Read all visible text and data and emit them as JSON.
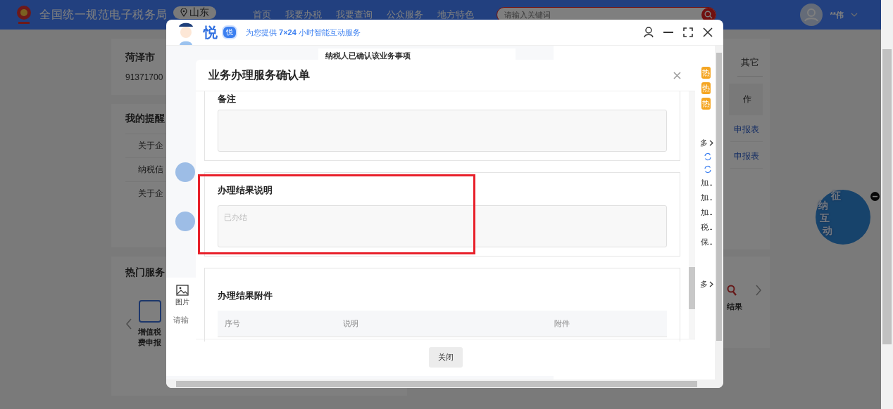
{
  "header": {
    "site_title": "全国统一规范电子税务局",
    "region": "山东",
    "nav": [
      "首页",
      "我要办税",
      "我要查询",
      "公众服务",
      "地方特色"
    ],
    "search": {
      "placeholder": "请输入关键词"
    },
    "user": "**伟"
  },
  "company": {
    "name": "菏泽市",
    "tax_id": "91371700"
  },
  "reminders": {
    "title": "我的提醒",
    "items": [
      "关于企",
      "纳税信",
      "关于企"
    ]
  },
  "hot_services": {
    "title": "热门服务",
    "items": [
      {
        "lines": [
          "增值税",
          "费申报"
        ]
      }
    ]
  },
  "right_column": {
    "tab": "其它",
    "action": "作",
    "links": [
      "申报表",
      "申报表"
    ],
    "service": "结果"
  },
  "float_widget": {
    "label": "征纳互动"
  },
  "chat": {
    "brand": "悦",
    "badge": "悦",
    "tagline": "为您提供 **7×24** 小时智能互动服务",
    "messages": [
      "纳税人已确认该业务事项"
    ],
    "toolbar": [
      "图片"
    ],
    "input": {
      "placeholder": "请输"
    },
    "hot_badges": [
      "热",
      "热",
      "热"
    ],
    "more_links": [
      "多",
      "多"
    ],
    "quick_items": [
      "加...",
      "加...",
      "加...",
      "税...",
      "保..."
    ]
  },
  "modal": {
    "title": "业务办理服务确认单",
    "sections": [
      {
        "kind": "textarea",
        "label": "备注"
      },
      {
        "kind": "textarea",
        "label": "办理结果说明",
        "value": "已办结",
        "highlighted": true
      },
      {
        "kind": "table",
        "label": "办理结果附件",
        "columns": [
          "序号",
          "说明",
          "附件"
        ]
      }
    ],
    "buttons": [
      "关闭"
    ]
  }
}
